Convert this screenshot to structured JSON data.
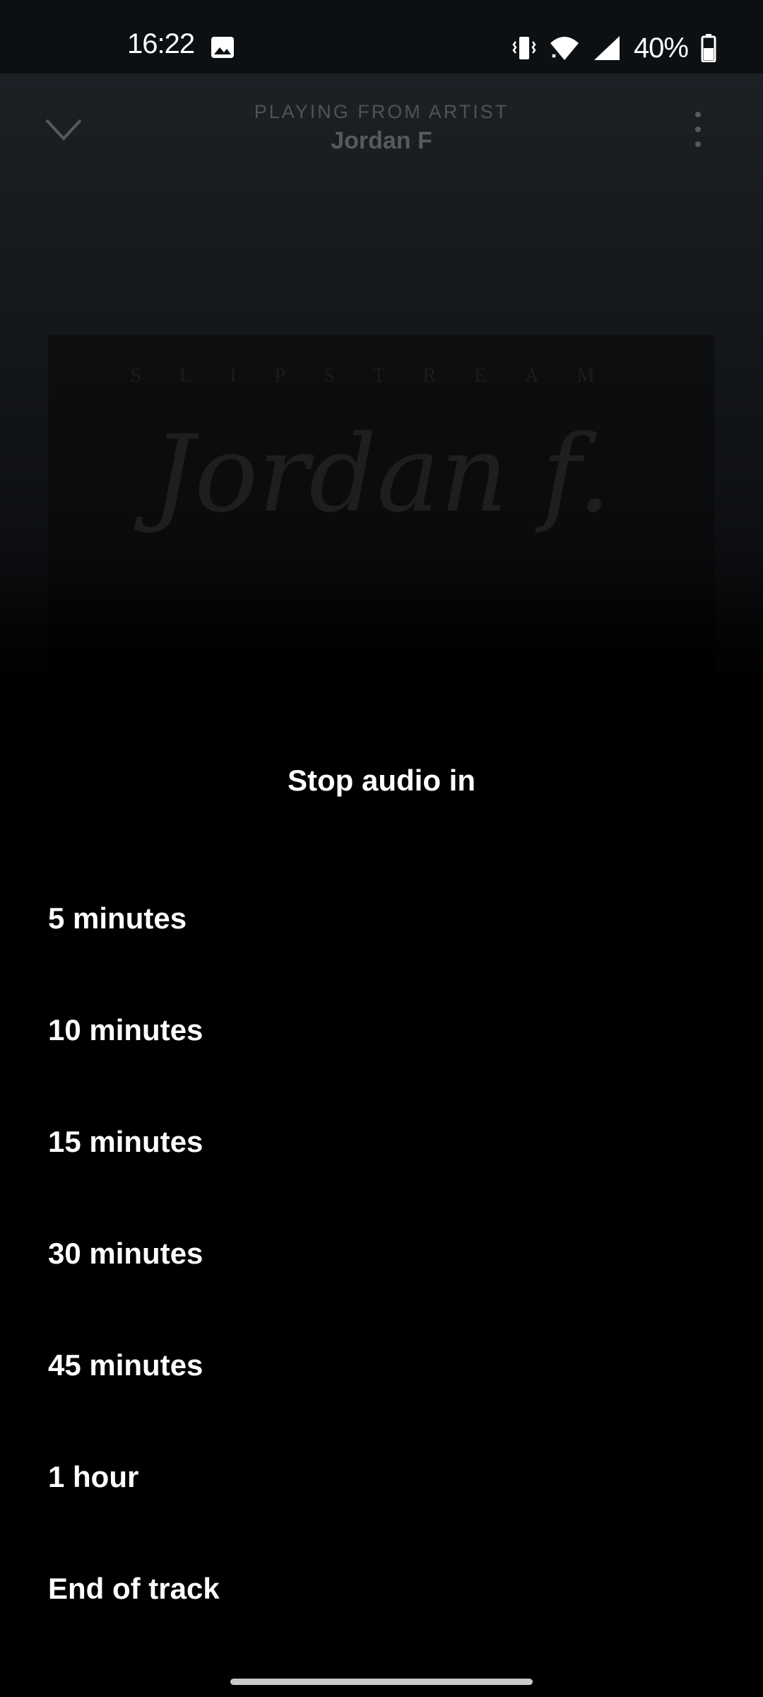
{
  "status_bar": {
    "time": "16:22",
    "battery_percent": "40%",
    "icons": [
      "gallery-icon",
      "vibrate-icon",
      "wifi-icon",
      "signal-icon",
      "battery-icon"
    ]
  },
  "player": {
    "header_subtitle": "PLAYING FROM ARTIST",
    "header_title": "Jordan F",
    "album_art": {
      "top_text": "SLIPSTREAM",
      "script_text": "Jordan f."
    }
  },
  "sleep_timer": {
    "title": "Stop audio in",
    "options": [
      {
        "label": "5 minutes"
      },
      {
        "label": "10 minutes"
      },
      {
        "label": "15 minutes"
      },
      {
        "label": "30 minutes"
      },
      {
        "label": "45 minutes"
      },
      {
        "label": "1 hour"
      },
      {
        "label": "End of track"
      }
    ]
  },
  "colors": {
    "background": "#000000",
    "text": "#ffffff",
    "dimmed_header": "#575a5d"
  }
}
